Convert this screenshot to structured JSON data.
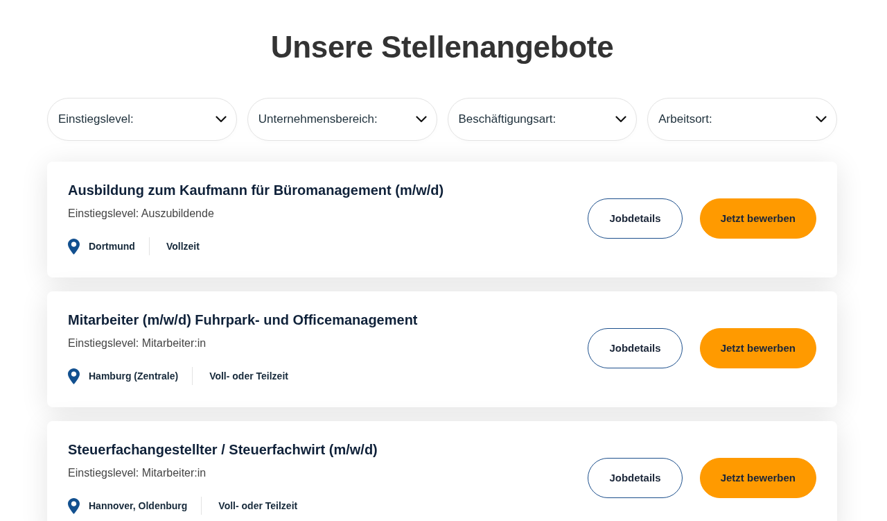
{
  "heading": "Unsere Stellenangebote",
  "filters": [
    {
      "label": "Einstiegslevel:"
    },
    {
      "label": "Unternehmensbereich:"
    },
    {
      "label": "Beschäftigungsart:"
    },
    {
      "label": "Arbeitsort:"
    }
  ],
  "jobs": [
    {
      "title": "Ausbildung zum Kaufmann für Büromanagement (m/w/d)",
      "level": "Einstiegslevel: Auszubildende",
      "location": "Dortmund",
      "employment": "Vollzeit",
      "actions": [
        {
          "kind": "outline",
          "label": "Jobdetails"
        },
        {
          "kind": "primary",
          "label": "Jetzt bewerben"
        }
      ]
    },
    {
      "title": "Mitarbeiter (m/w/d) Fuhrpark- und Officemanagement",
      "level": "Einstiegslevel: Mitarbeiter:in",
      "location": "Hamburg (Zentrale)",
      "employment": "Voll- oder Teilzeit",
      "actions": [
        {
          "kind": "outline",
          "label": "Jobdetails"
        },
        {
          "kind": "primary",
          "label": "Jetzt bewerben"
        }
      ]
    },
    {
      "title": "Steuerfachangestellter / Steuerfachwirt (m/w/d)",
      "level": "Einstiegslevel: Mitarbeiter:in",
      "location": "Hannover, Oldenburg",
      "employment": "Voll- oder Teilzeit",
      "actions": [
        {
          "kind": "outline",
          "label": "Jobdetails"
        },
        {
          "kind": "primary",
          "label": "Jetzt bewerben"
        }
      ]
    }
  ]
}
